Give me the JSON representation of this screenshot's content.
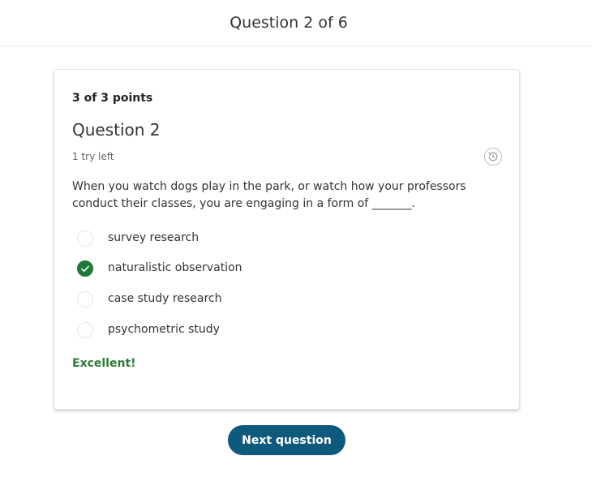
{
  "header": {
    "title": "Question 2 of 6"
  },
  "card": {
    "points": "3 of 3 points",
    "question_title": "Question 2",
    "tries_left": "1 try left",
    "history_icon": "history-icon",
    "prompt": "When you watch dogs play in the park, or watch how your professors conduct their classes, you are engaging in a form of _______.",
    "options": [
      {
        "label": "survey research",
        "selected": false
      },
      {
        "label": "naturalistic observation",
        "selected": true
      },
      {
        "label": "case study research",
        "selected": false
      },
      {
        "label": "psychometric study",
        "selected": false
      }
    ],
    "feedback": "Excellent!"
  },
  "next_button": {
    "label": "Next question"
  },
  "colors": {
    "correct": "#1e7a3a",
    "feedback": "#2e7d32",
    "button": "#0d5a7c"
  }
}
